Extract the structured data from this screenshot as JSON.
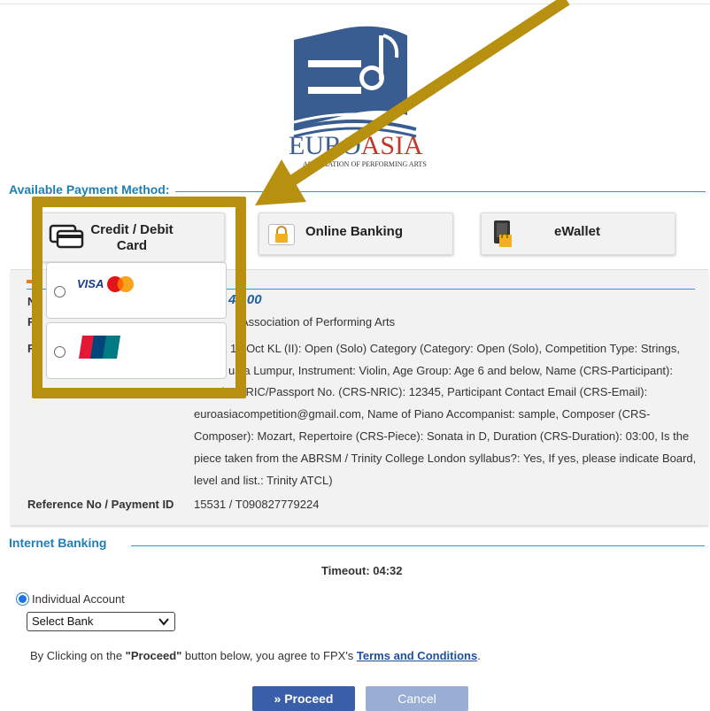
{
  "logo": {
    "brand_euro": "EURO",
    "brand_asia": "ASIA",
    "subtitle": "ASSOCIATION OF PERFORMING ARTS"
  },
  "payment_method": {
    "title": "Available Payment Method:",
    "tabs": [
      {
        "label": "Credit / Debit Card",
        "icon": "credit-card-icon"
      },
      {
        "label": "Online Banking",
        "icon": "lock-icon"
      },
      {
        "label": "eWallet",
        "icon": "wallet-icon"
      }
    ],
    "card_options": [
      {
        "brand": "VISA",
        "brand2": "MasterCard",
        "selected": false
      },
      {
        "brand": "UnionPay",
        "brand_cn": "银联",
        "selected": false
      }
    ]
  },
  "order": {
    "amount": "40.00",
    "payee": "Association of Performing Arts",
    "description_lines": [
      "13 Oct KL (II): Open (Solo) Category (Category: Open (Solo), Competition Type: Strings,",
      "uala Lumpur, Instrument: Violin, Age Group: Age 6 and below, Name (CRS-Participant):",
      "sample, NRIC/Passport No. (CRS-NRIC): 12345, Participant Contact Email (CRS-Email):",
      "euroasiacompetition@gmail.com, Name of Piano Accompanist: sample, Composer (CRS-",
      "Composer): Mozart, Repertoire (CRS-Piece): Sonata in D, Duration (CRS-Duration): 03:00, Is the",
      "piece taken from the ABRSM / Trinity College London syllabus?: Yes, If yes, please indicate Board,",
      "level and list.: Trinity ATCL)"
    ],
    "label_n": "N",
    "label_f1": "F",
    "label_f2": "F",
    "reference_label": "Reference No / Payment ID",
    "reference_value": "15531 / T090827779224"
  },
  "internet_banking": {
    "title": "Internet Banking",
    "timeout": "Timeout: 04:32",
    "account_type": "Individual Account",
    "bank_select": "Select Bank",
    "agree_prefix": "By Clicking on the ",
    "agree_bold": "\"Proceed\"",
    "agree_mid": " button below, you agree to FPX's ",
    "agree_link": "Terms and Conditions",
    "agree_suffix": ".",
    "proceed_label": "» Proceed",
    "cancel_label": "Cancel"
  },
  "colors": {
    "accent": "#1f7fb6",
    "highlight_frame": "#b8900f",
    "proceed": "#3a5ea8",
    "cancel": "#9aaed3"
  }
}
